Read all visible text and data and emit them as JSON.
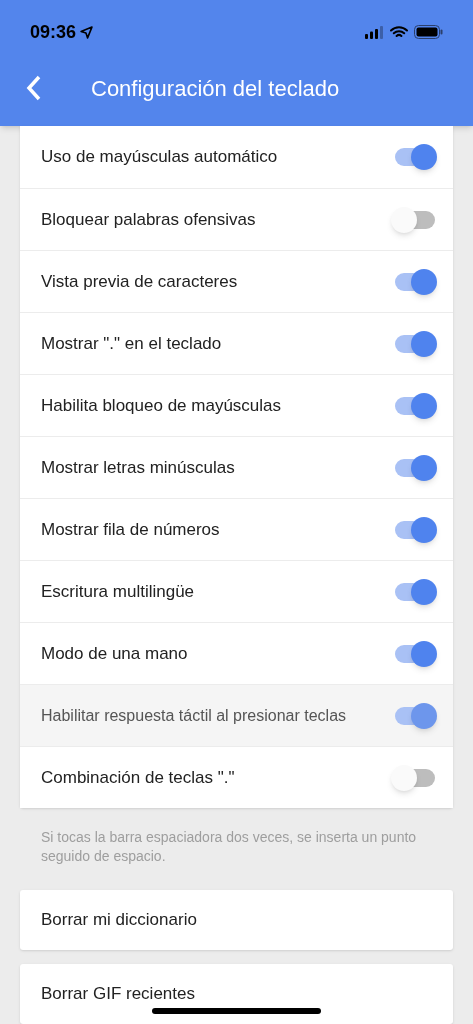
{
  "status_bar": {
    "time": "09:36"
  },
  "header": {
    "title": "Configuración del teclado"
  },
  "settings": [
    {
      "label": "Uso de mayúsculas automático",
      "on": true,
      "highlighted": false
    },
    {
      "label": "Bloquear palabras ofensivas",
      "on": false,
      "highlighted": false
    },
    {
      "label": "Vista previa de caracteres",
      "on": true,
      "highlighted": false
    },
    {
      "label": "Mostrar \".\" en el teclado",
      "on": true,
      "highlighted": false
    },
    {
      "label": "Habilita bloqueo de mayúsculas",
      "on": true,
      "highlighted": false
    },
    {
      "label": "Mostrar letras minúsculas",
      "on": true,
      "highlighted": false
    },
    {
      "label": "Mostrar fila de números",
      "on": true,
      "highlighted": false
    },
    {
      "label": "Escritura multilingüe",
      "on": true,
      "highlighted": false
    },
    {
      "label": "Modo de una mano",
      "on": true,
      "highlighted": false
    },
    {
      "label": "Habilitar respuesta táctil al presionar teclas",
      "on": true,
      "highlighted": true
    },
    {
      "label": "Combinación de teclas \".\"",
      "on": false,
      "highlighted": false
    }
  ],
  "note": "Si tocas la barra espaciadora dos veces, se inserta un punto seguido de espacio.",
  "actions": [
    {
      "label": "Borrar mi diccionario"
    },
    {
      "label": "Borrar GIF recientes"
    }
  ]
}
